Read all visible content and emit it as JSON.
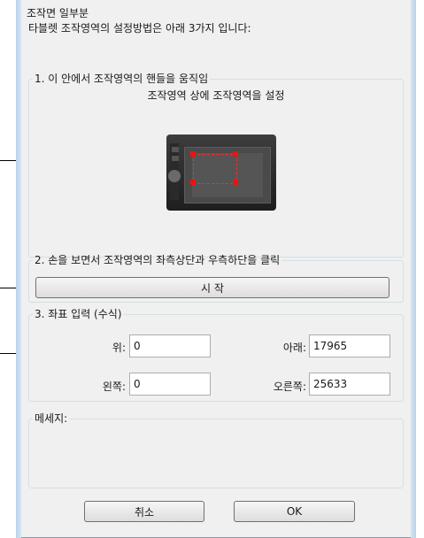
{
  "dialog": {
    "title": "조작면 일부분",
    "description": "타블렛 조작영역의 설정방법은 아래 3가지 입니다:"
  },
  "section1": {
    "legend": "1. 이 안에서 조작영역의 핸들을 움직임",
    "subtitle": "조작영역 상에 조작영역을 설정"
  },
  "section2": {
    "legend": "2. 손을 보면서 조작영역의 좌측상단과 우측하단을 클릭",
    "start_button": "시 작"
  },
  "section3": {
    "legend": "3. 좌표 입력 (수식)",
    "top_label": "위:",
    "top_value": "0",
    "bottom_label": "아래:",
    "bottom_value": "17965",
    "left_label": "왼쪽:",
    "left_value": "0",
    "right_label": "오른쪽:",
    "right_value": "25633"
  },
  "message": {
    "legend": "메세지:"
  },
  "footer": {
    "cancel_label": "취소",
    "ok_label": "OK"
  },
  "colors": {
    "dialog_bg": "#f0f0f0",
    "selection_handle": "#ee1111"
  }
}
